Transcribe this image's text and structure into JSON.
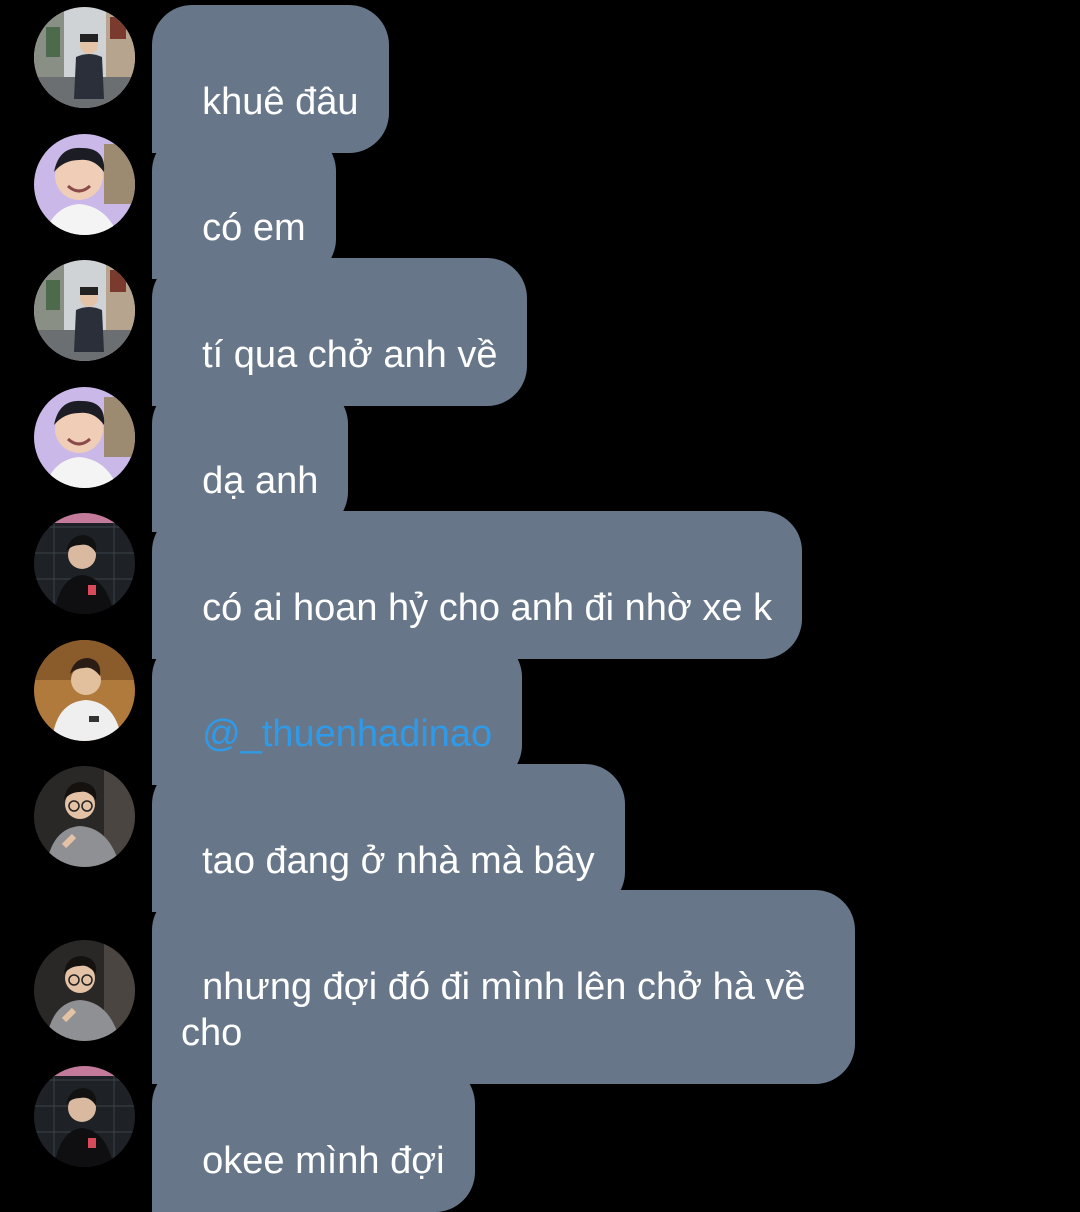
{
  "colors": {
    "background": "#000000",
    "bubble": "#677789",
    "text": "#ffffff",
    "mention": "#2f9ae8"
  },
  "messages": [
    {
      "text": "khuê đâu",
      "avatar": "avatar-street-boy"
    },
    {
      "text": "có em",
      "avatar": "avatar-smiling-boy"
    },
    {
      "text": "tí qua chở anh về",
      "avatar": "avatar-street-boy"
    },
    {
      "text": "dạ anh",
      "avatar": "avatar-smiling-boy"
    },
    {
      "text": "có ai hoan hỷ cho anh đi nhờ xe k",
      "avatar": "avatar-dark-shirt-boy"
    },
    {
      "text": "@_thuenhadinao",
      "avatar": "avatar-hoodie-boy"
    },
    {
      "text": "tao đang ở nhà mà bây",
      "avatar": "avatar-glasses-boy"
    },
    {
      "text": "nhưng đợi đó đi mình lên chở hà về cho",
      "avatar": "avatar-glasses-boy"
    },
    {
      "text": "okee mình đợi",
      "avatar": "avatar-dark-shirt-boy"
    }
  ]
}
